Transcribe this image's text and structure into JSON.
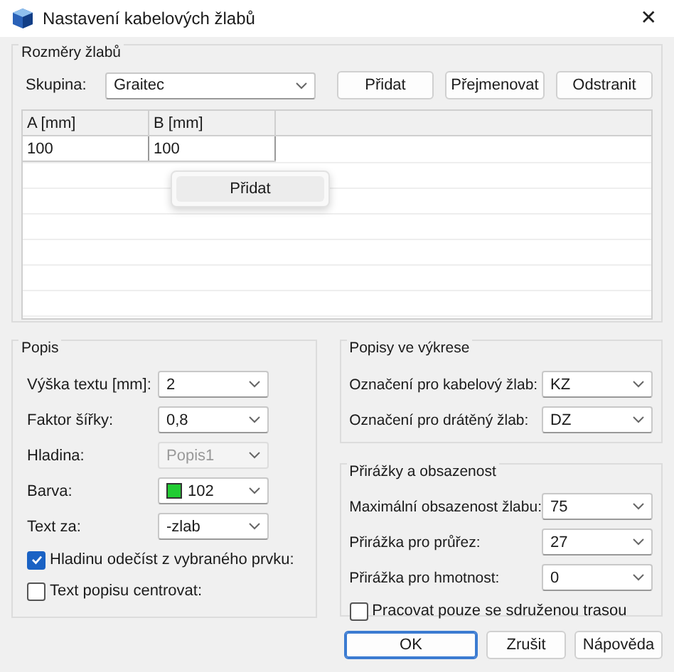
{
  "window": {
    "title": "Nastavení kabelových žlabů",
    "close": "✕"
  },
  "dimensions": {
    "title": "Rozměry žlabů",
    "group_label": "Skupina:",
    "group_value": "Graitec",
    "buttons": [
      "Přidat",
      "Přejmenovat",
      "Odstranit"
    ],
    "table": {
      "columns": [
        "A [mm]",
        "B [mm]"
      ],
      "rows": [
        [
          "100",
          "100"
        ]
      ]
    },
    "context_menu": [
      "Přidat"
    ]
  },
  "popis": {
    "title": "Popis",
    "fields": [
      {
        "label": "Výška textu [mm]:",
        "value": "2",
        "kind": "combo",
        "disabled": false
      },
      {
        "label": "Faktor šířky:",
        "value": "0,8",
        "kind": "combo",
        "disabled": false
      },
      {
        "label": "Hladina:",
        "value": "Popis1",
        "kind": "combo",
        "disabled": true
      },
      {
        "label": "Barva:",
        "value": "102",
        "kind": "color",
        "disabled": false,
        "color": "#22cc33"
      },
      {
        "label": "Text za:",
        "value": "-zlab",
        "kind": "combo",
        "disabled": false
      }
    ],
    "checkboxes": [
      {
        "label": "Hladinu odečíst z vybraného prvku:",
        "checked": true
      },
      {
        "label": "Text popisu centrovat:",
        "checked": false
      }
    ]
  },
  "drawing_labels": {
    "title": "Popisy ve výkrese",
    "fields": [
      {
        "label": "Označení pro kabelový žlab:",
        "value": "KZ"
      },
      {
        "label": "Označení pro drátěný žlab:",
        "value": "DZ"
      }
    ]
  },
  "surcharges": {
    "title": "Přirážky a obsazenost",
    "fields": [
      {
        "label": "Maximální obsazenost žlabu:",
        "value": "75"
      },
      {
        "label": "Přirážka pro průřez:",
        "value": "27"
      },
      {
        "label": "Přirážka pro hmotnost:",
        "value": "0"
      }
    ],
    "checkboxes": [
      {
        "label": "Pracovat pouze se sdruženou trasou",
        "checked": false
      }
    ]
  },
  "buttons": [
    {
      "label": "OK",
      "default": true
    },
    {
      "label": "Zrušit",
      "default": false
    },
    {
      "label": "Nápověda",
      "default": false
    }
  ]
}
